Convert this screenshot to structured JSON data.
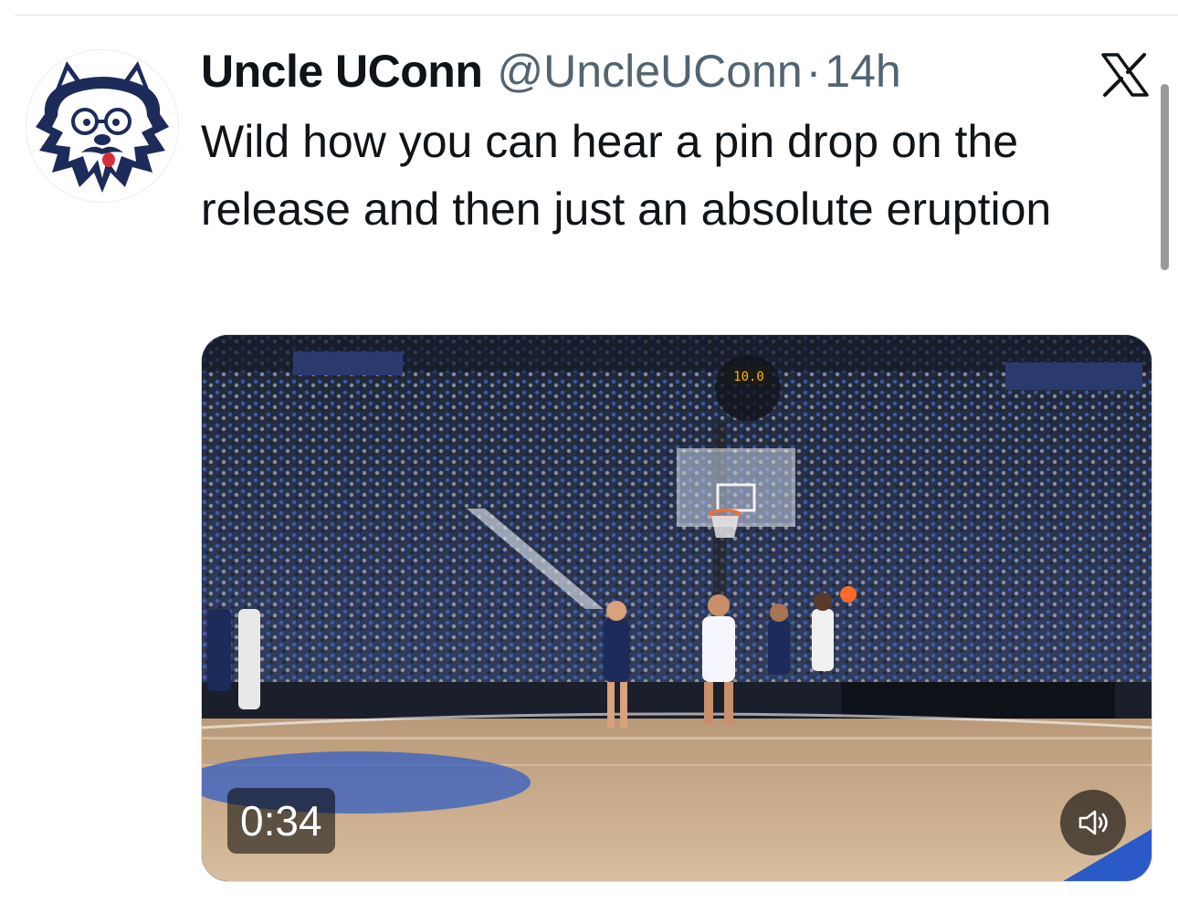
{
  "tweet": {
    "display_name": "Uncle UConn",
    "handle": "@UncleUConn",
    "separator": "·",
    "time": "14h",
    "text": "Wild how you can hear a pin drop on the release and then just an absolute eruption",
    "avatar_icon": "husky-mascot-icon",
    "platform_icon": "x-logo-icon"
  },
  "media": {
    "duration": "0:34",
    "shot_clock": "10.0",
    "mute_icon": "speaker-muted-icon"
  },
  "colors": {
    "text_primary": "#0f1419",
    "text_secondary": "#536471",
    "court_floor": "#c9ab88",
    "uconn_navy": "#1c2b5a"
  }
}
